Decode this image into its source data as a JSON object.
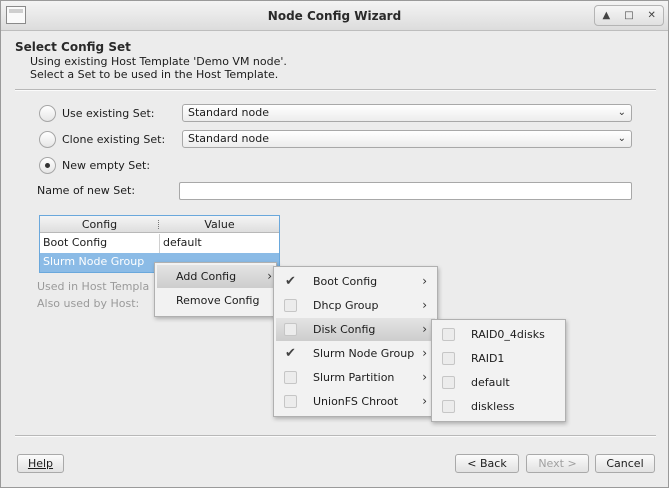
{
  "window": {
    "title": "Node Config Wizard"
  },
  "header": {
    "title": "Select Config Set",
    "line1": "Using existing Host Template 'Demo VM node'.",
    "line2": "Select a Set to be used in the Host Template."
  },
  "form": {
    "use_existing_label": "Use existing Set:",
    "use_existing_value": "Standard node",
    "clone_existing_label": "Clone existing Set:",
    "clone_existing_value": "Standard node",
    "new_empty_label": "New empty Set:",
    "selected_option": "new_empty",
    "name_label": "Name of new Set:",
    "name_value": ""
  },
  "table": {
    "headers": [
      "Config",
      "Value"
    ],
    "rows": [
      {
        "config": "Boot Config",
        "value": "default"
      },
      {
        "config": "Slurm Node Group",
        "value": ""
      }
    ],
    "selected_row": 1
  },
  "info": {
    "used_in_label": "Used in Host Templa",
    "also_used_label": "Also used by Host:"
  },
  "context_menu": {
    "items": [
      "Add Config",
      "Remove Config"
    ],
    "highlighted": 0
  },
  "add_config_menu": {
    "items": [
      {
        "label": "Boot Config",
        "checked": true
      },
      {
        "label": "Dhcp Group",
        "checked": false
      },
      {
        "label": "Disk Config",
        "checked": false
      },
      {
        "label": "Slurm Node Group",
        "checked": true
      },
      {
        "label": "Slurm Partition",
        "checked": false
      },
      {
        "label": "UnionFS Chroot",
        "checked": false
      }
    ],
    "highlighted": 2
  },
  "disk_config_menu": {
    "items": [
      {
        "label": "RAID0_4disks",
        "checked": false
      },
      {
        "label": "RAID1",
        "checked": false
      },
      {
        "label": "default",
        "checked": false
      },
      {
        "label": "diskless",
        "checked": false
      }
    ]
  },
  "buttons": {
    "help": "Help",
    "back": "< Back",
    "next": "Next >",
    "cancel": "Cancel"
  },
  "icons": {
    "window_menu": "window-menu-icon",
    "minimize": "▲",
    "maximize": "□",
    "close": "✕",
    "dropdown": "⌄",
    "submenu": "›",
    "check": "✔"
  }
}
